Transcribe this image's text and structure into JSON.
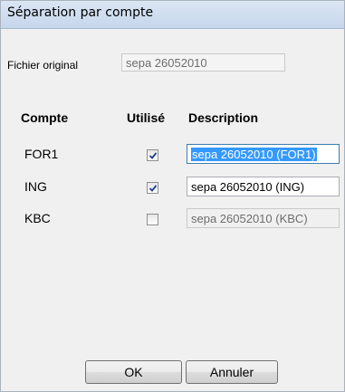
{
  "window": {
    "title": "Séparation par compte"
  },
  "source": {
    "label": "Fichier original",
    "value": "sepa 26052010"
  },
  "table": {
    "headers": {
      "account": "Compte",
      "used": "Utilisé",
      "description": "Description"
    },
    "rows": [
      {
        "account": "FOR1",
        "used": true,
        "description": "sepa 26052010 (FOR1)",
        "description_state": "selected"
      },
      {
        "account": "ING",
        "used": true,
        "description": "sepa 26052010 (ING)",
        "description_state": "enabled"
      },
      {
        "account": "KBC",
        "used": false,
        "description": "sepa 26052010 (KBC)",
        "description_state": "disabled"
      }
    ]
  },
  "buttons": {
    "ok": "OK",
    "cancel": "Annuler"
  },
  "icons": {
    "checkmark": "checkmark-icon"
  },
  "colors": {
    "selection": "#3399ff",
    "checkmark": "#1d3e8a"
  }
}
